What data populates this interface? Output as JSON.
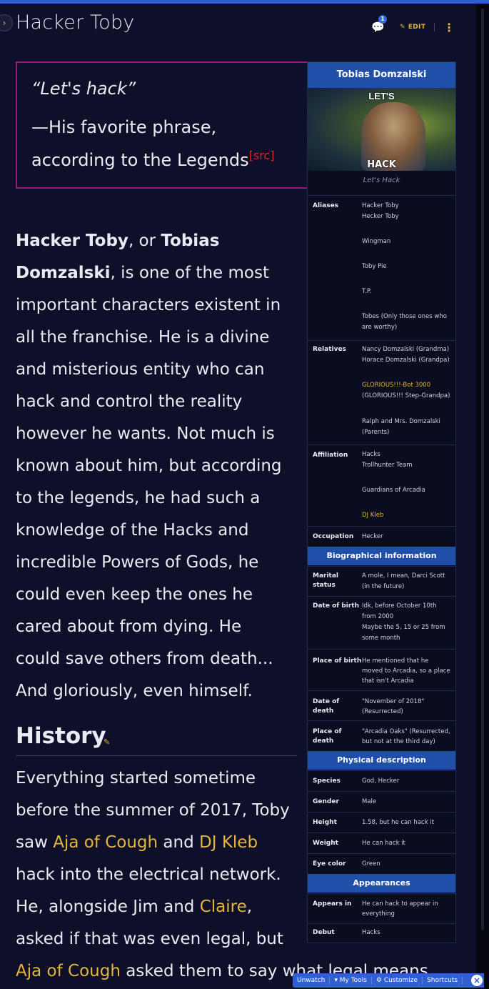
{
  "page": {
    "title": "Hacker Toby",
    "edit_label": "EDIT",
    "comment_count": "1"
  },
  "quote": {
    "text": "“Let's hack”",
    "attribution_line1": "—His favorite phrase,",
    "attribution_line2": "according to the Legends",
    "src": "[src]"
  },
  "infobox": {
    "title": "Tobias Domzalski",
    "image_text_top": "LET'S",
    "image_text_bottom": "HACK",
    "caption": "Let's Hack",
    "rows": [
      {
        "label": "Aliases",
        "values": [
          "Hacker Toby",
          "Hecker Toby",
          "Wingman",
          "Toby Pie",
          "T.P.",
          "Tobes (Only those ones who",
          "are worthy)"
        ]
      },
      {
        "label": "Relatives",
        "values": [
          "Nancy Domzalski (Grandma)",
          "Horace Domzalski (Grandpa)",
          "GLORIOUS!!!-Bot 3000",
          "(GLORIOUS!!! Step-Grandpa)",
          "Ralph and Mrs. Domzalski",
          "(Parents)"
        ]
      },
      {
        "label": "Affiliation",
        "values": [
          "Hacks",
          "Trollhunter Team",
          "Guardians of Arcadia",
          "DJ Kleb"
        ]
      },
      {
        "label": "Occupation",
        "values": [
          "Hecker"
        ]
      }
    ],
    "section_bio": "Biographical information",
    "bio_rows": [
      {
        "label1": "Marital",
        "label2": "status",
        "values": [
          "A mole, I mean, Darci Scott",
          "(in the future)"
        ]
      },
      {
        "label1": "Date of birth",
        "label2": "",
        "values": [
          "Idk, before October 10th",
          "from 2000",
          "Maybe the 5, 15 or 25 from",
          "some month"
        ]
      },
      {
        "label1": "Place of birth",
        "label2": "",
        "values": [
          "He mentioned that he",
          "moved to Arcadia, so a place",
          "that isn't Arcadia"
        ]
      },
      {
        "label1": "Date of",
        "label2": "death",
        "values": [
          "\"November of 2018\"",
          "(Resurrected)"
        ]
      },
      {
        "label1": "Place of",
        "label2": "death",
        "values": [
          "\"Arcadia Oaks\" (Resurrected,",
          "but not at the third day)"
        ]
      }
    ],
    "section_physical": "Physical description",
    "phys_rows": [
      {
        "label": "Species",
        "value": "God, Hecker"
      },
      {
        "label": "Gender",
        "value": "Male"
      },
      {
        "label": "Height",
        "value": "1.58, but he can hack it"
      },
      {
        "label": "Weight",
        "value": "He can hack it"
      },
      {
        "label": "Eye color",
        "value": "Green"
      }
    ],
    "section_appearances": "Appearances",
    "app_rows": [
      {
        "label": "Appears in",
        "values": [
          "He can hack to appear in",
          "everything"
        ]
      },
      {
        "label": "Debut",
        "values": [
          "Hacks"
        ]
      }
    ]
  },
  "intro": {
    "name1": "Hacker Toby",
    "or": ", or ",
    "name2": "Tobias",
    "name2b": "Domzalski",
    "rest_first": ", is one of the most",
    "lines": [
      "important characters existent in",
      "all the franchise. He is a divine",
      "and misterious entity who can",
      "hack and control the reality",
      "however he wants. Not much is",
      "known about him, but according",
      "to the legends, he had such a",
      "knowledge of the Hacks and",
      "incredible Powers of Gods, he",
      "could even keep the ones he",
      "cared about from dying. He",
      "could save others from death...",
      "And gloriously, even himself."
    ]
  },
  "history": {
    "title": "History",
    "l1": "Everything started sometime",
    "l2": "before the summer of 2017, Toby",
    "l3a": "saw ",
    "l3link1": "Aja of Cough",
    "l3b": " and ",
    "l3link2": "DJ Kleb",
    "l4": "hack into the electrical network.",
    "l5a": "He, alongside Jim and ",
    "l5link": "Claire",
    "l5b": ",",
    "l6": "asked if that was even legal, but",
    "l7link": "Aja of Cough",
    "l7b": " asked them to say what legal means"
  },
  "toolbar": {
    "unwatch": "Unwatch",
    "my_tools": "My Tools",
    "customize": "Customize",
    "shortcuts": "Shortcuts"
  },
  "colors": {
    "accent": "#e3b53b",
    "infobox_header": "#1f4fa8",
    "quote_border": "#8b1f86",
    "background": "#0e1029"
  }
}
